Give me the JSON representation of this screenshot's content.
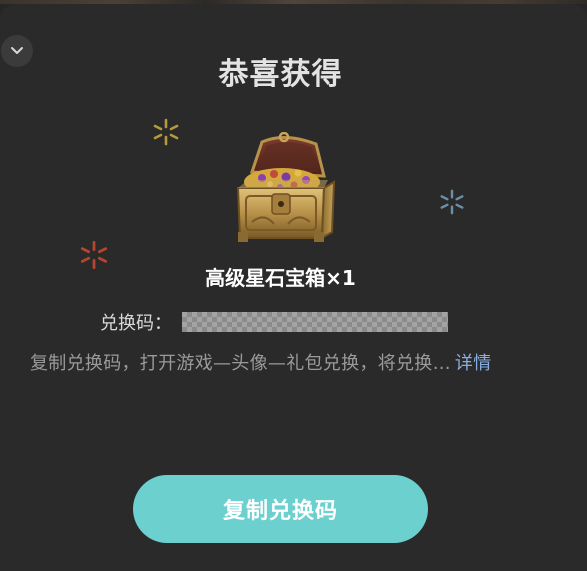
{
  "dialog": {
    "title": "恭喜获得",
    "collapse_icon": "chevron-down-icon",
    "reward": {
      "icon": "treasure-chest-icon",
      "name": "高级星石宝箱×1"
    },
    "code": {
      "label": "兑换码："
    },
    "instructions": {
      "text": "复制兑换码，打开游戏—头像—礼包兑换，将兑换…",
      "details_link": "详情"
    },
    "copy_button": "复制兑换码"
  },
  "colors": {
    "background": "#2a2a2a",
    "accent": "#6cd0cf",
    "link": "#8aaee0",
    "sparkle_gold": "#b39a3a",
    "sparkle_red": "#b5452f",
    "sparkle_blue": "#6d8fa6"
  }
}
